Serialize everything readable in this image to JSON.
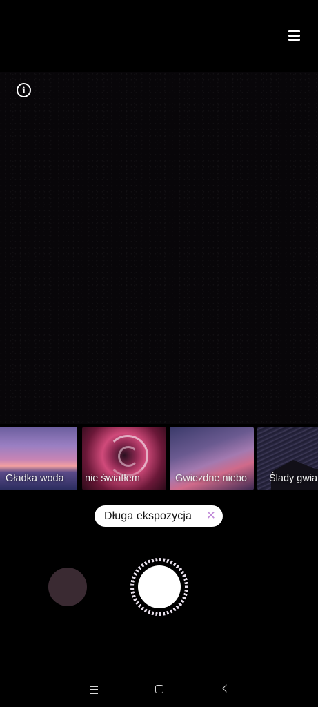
{
  "top_bar": {
    "menu_icon": "menu-icon"
  },
  "viewfinder": {
    "info_icon": "info-icon",
    "info_glyph": "i"
  },
  "modes": [
    {
      "label": "Gładka woda"
    },
    {
      "label": "nie światłem"
    },
    {
      "label": "Gwiezdne niebo"
    },
    {
      "label": "Ślady gwia"
    }
  ],
  "active_mode_chip": {
    "label": "Długa ekspozycja",
    "close_glyph": "✕"
  },
  "controls": {
    "gallery": "gallery-thumbnail",
    "shutter": "shutter-button"
  },
  "nav_bar": {
    "recents": "recents-icon",
    "home": "home-icon",
    "back": "back-icon"
  },
  "colors": {
    "background": "#000000",
    "chip_bg": "#ffffff",
    "chip_close": "#c08ad8"
  }
}
